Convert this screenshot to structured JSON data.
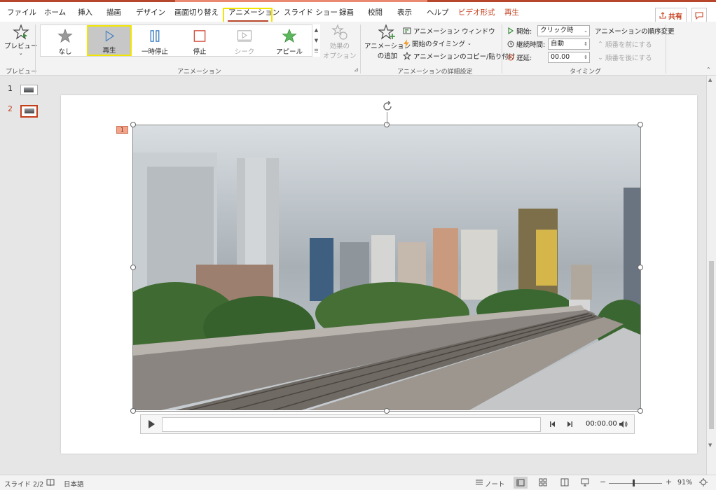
{
  "tabs": {
    "items": [
      "ファイル",
      "ホーム",
      "挿入",
      "描画",
      "デザイン",
      "画面切り替え",
      "アニメーション",
      "スライド ショー",
      "録画",
      "校閲",
      "表示",
      "ヘルプ",
      "ビデオ形式",
      "再生"
    ],
    "active": "アニメーション",
    "share_label": "共有"
  },
  "ribbon": {
    "preview": {
      "button": "プレビュー",
      "group": "プレビュー"
    },
    "animation": {
      "group": "アニメーション",
      "gallery": [
        {
          "label": "なし"
        },
        {
          "label": "再生"
        },
        {
          "label": "一時停止"
        },
        {
          "label": "停止"
        },
        {
          "label": "シーク"
        },
        {
          "label": "アピール"
        }
      ],
      "effect_options_line1": "効果の",
      "effect_options_line2": "オプション"
    },
    "advanced": {
      "group": "アニメーションの詳細設定",
      "add_line1": "アニメーション",
      "add_line2": "の追加",
      "pane": "アニメーション ウィンドウ",
      "trigger": "開始のタイミング",
      "painter": "アニメーションのコピー/貼り付け"
    },
    "timing": {
      "group": "タイミング",
      "start_label": "開始:",
      "start_value": "クリック時",
      "duration_label": "継続時間:",
      "duration_value": "自動",
      "delay_label": "遅延:",
      "delay_value": "00.00",
      "reorder_title": "アニメーションの順序変更",
      "move_earlier": "順番を前にする",
      "move_later": "順番を後にする"
    }
  },
  "thumbnails": {
    "slides": [
      {
        "number": "1"
      },
      {
        "number": "2"
      }
    ]
  },
  "slide": {
    "anim_tag": "1",
    "media_time": "00:00.00"
  },
  "status": {
    "slide_info": "スライド 2/2",
    "language": "日本語",
    "notes": "ノート",
    "zoom": "91%"
  },
  "colors": {
    "accent": "#b7472a",
    "highlight": "#f2e600"
  }
}
